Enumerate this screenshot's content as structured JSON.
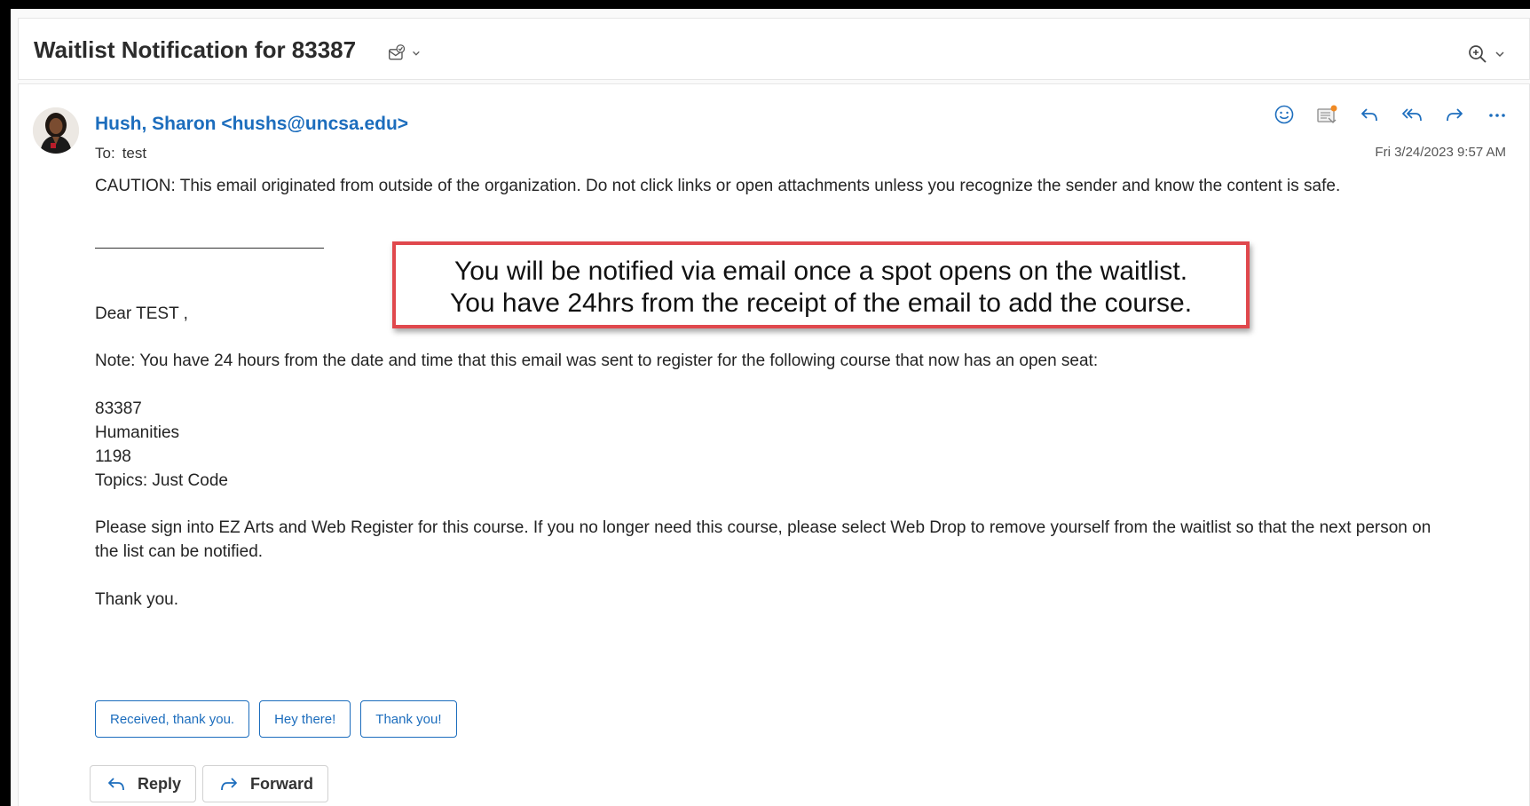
{
  "subject": {
    "title": "Waitlist Notification for 83387"
  },
  "header": {
    "sender": "Hush, Sharon <hushs@uncsa.edu>",
    "to_label": "To:",
    "to_value": "test",
    "date": "Fri 3/24/2023 9:57 AM",
    "action_icons": [
      "emoji-react-icon",
      "reading-pane-icon",
      "reply-icon",
      "reply-all-icon",
      "forward-icon",
      "more-icon"
    ]
  },
  "body": {
    "caution": "CAUTION: This email originated from outside of the organization. Do not click links or open attachments unless you recognize the sender and know the content is safe.",
    "greeting": "Dear TEST ,",
    "note": "Note:  You have 24 hours from the date and time that this email was sent to register for the following course that now has an open seat:",
    "course_lines": [
      "83387",
      "Humanities",
      "1198",
      "Topics: Just Code"
    ],
    "instructions_line1": "Please sign into EZ Arts and Web Register for this course.  If you no longer need this course, please select Web Drop to remove yourself from the waitlist so that the next person on",
    "instructions_line2": "the list can be notified.",
    "closing": "Thank you."
  },
  "callout": {
    "line1": "You will be notified via email once a spot opens on the waitlist.",
    "line2": "You have 24hrs from the receipt of the email to add the course.",
    "border_color": "#e0484d"
  },
  "quick_replies": [
    "Received, thank you.",
    "Hey there!",
    "Thank you!"
  ],
  "bottom_actions": {
    "reply": "Reply",
    "forward": "Forward"
  },
  "colors": {
    "accent": "#1c6dbd",
    "text": "#242424"
  }
}
